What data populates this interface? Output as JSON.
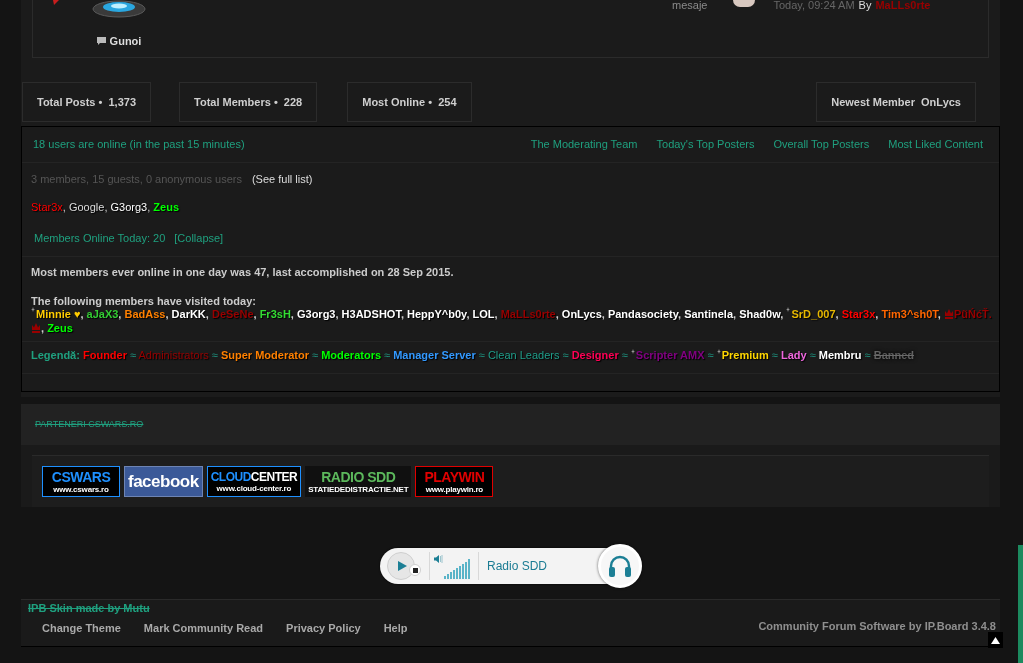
{
  "forum_row": {
    "forum": "Gunoi",
    "count_label": "mesaje",
    "last_post": {
      "time": "Today, 09:24 AM",
      "by": "By",
      "author": "MaLLs0rte"
    }
  },
  "stats": [
    {
      "label": "Total Posts •",
      "value": "1,373"
    },
    {
      "label": "Total Members •",
      "value": "228"
    },
    {
      "label": "Most Online •",
      "value": "254"
    },
    {
      "label": "Newest Member",
      "value": "OnLycs"
    }
  ],
  "online": {
    "title": "18 users are online (in the past 15 minutes)",
    "links": [
      "The Moderating Team",
      "Today's Top Posters",
      "Overall Top Posters",
      "Most Liked Content"
    ],
    "summary": "3 members, 15 guests, 0 anonymous users",
    "see_full_list": "(See full list)",
    "users": [
      {
        "name": "Star3x",
        "color": "#ff0000",
        "bold": false,
        "sep": ","
      },
      {
        "name": "Google",
        "color": "#dddddd",
        "bold": false,
        "sep": ","
      },
      {
        "name": "G3org3",
        "color": "#ffffff",
        "bold": false,
        "sep": ","
      },
      {
        "name": "Zeus",
        "color": "#00ff00",
        "bold": true
      }
    ],
    "today": "Members Online Today: 20",
    "collapse": "[Collapse]"
  },
  "records": {
    "most_online": "Most members ever online in one day was 47, last accomplished on 28 Sep 2015.",
    "visited_title": "The following members have visited today:",
    "visited": [
      {
        "name": "Minnie ♥",
        "color": "#ffcc00",
        "kind": "sparkle",
        "sep": ","
      },
      {
        "name": "aJaX3",
        "color": "#33cc33",
        "kind": "plain",
        "sep": ","
      },
      {
        "name": "BadAss",
        "color": "#ff8000",
        "kind": "plain",
        "sep": ","
      },
      {
        "name": "DarKK",
        "color": "#ffffff",
        "kind": "plain",
        "sep": ","
      },
      {
        "name": "DeSeNe",
        "color": "#990000",
        "kind": "plain",
        "sep": ","
      },
      {
        "name": "Fr3sH",
        "color": "#33dd33",
        "kind": "plain",
        "sep": ","
      },
      {
        "name": "G3org3",
        "color": "#ffffff",
        "kind": "plain",
        "sep": ","
      },
      {
        "name": "H3ADSHOT",
        "color": "#ffffff",
        "kind": "plain",
        "sep": ","
      },
      {
        "name": "HeppY^b0y",
        "color": "#ffffff",
        "kind": "plain",
        "sep": ","
      },
      {
        "name": "LOL",
        "color": "#ffffff",
        "kind": "plain",
        "sep": ","
      },
      {
        "name": "MaLLs0rte",
        "color": "#990000",
        "kind": "plain",
        "sep": ","
      },
      {
        "name": "OnLycs",
        "color": "#ffffff",
        "kind": "plain",
        "sep": ","
      },
      {
        "name": "Pandasociety",
        "color": "#ffffff",
        "kind": "plain",
        "sep": ","
      },
      {
        "name": "Santinela",
        "color": "#ffffff",
        "kind": "plain",
        "sep": ","
      },
      {
        "name": "Shad0w",
        "color": "#ffffff",
        "kind": "plain",
        "sep": ","
      },
      {
        "name": "SrD_007",
        "color": "#e6b800",
        "kind": "sparkle",
        "sep": ","
      },
      {
        "name": "Star3x",
        "color": "#ff0000",
        "kind": "plain",
        "sep": ","
      },
      {
        "name": "Tim3^sh0T",
        "color": "#ff6600",
        "kind": "plain",
        "sep": ","
      },
      {
        "name": "PũŃćŤ.",
        "color": "#990000",
        "kind": "emblem",
        "sep": ","
      },
      {
        "name": "Zeus",
        "color": "#00ff00",
        "kind": "plain"
      }
    ]
  },
  "legend": {
    "label": "Legendă:",
    "groups": [
      {
        "name": "Founder",
        "color": "#ff0000",
        "bold": true,
        "kind": "plain",
        "sep": "≈"
      },
      {
        "name": "Administrators",
        "color": "#990000",
        "bold": false,
        "kind": "plain",
        "sep": "≈"
      },
      {
        "name": "Super Moderator",
        "color": "#ff8000",
        "bold": true,
        "kind": "plain",
        "sep": "≈"
      },
      {
        "name": "Moderators",
        "color": "#00ff00",
        "bold": true,
        "kind": "plain",
        "sep": "≈"
      },
      {
        "name": "Manager Server",
        "color": "#3399ff",
        "bold": true,
        "kind": "plain",
        "sep": "≈"
      },
      {
        "name": "Clean Leaders",
        "color": "#1f9e8a",
        "bold": false,
        "kind": "plain",
        "sep": "≈"
      },
      {
        "name": "Designer",
        "color": "#ff0055",
        "bold": true,
        "kind": "plain",
        "sep": "≈"
      },
      {
        "name": "Scripter AMX",
        "color": "#800080",
        "bold": true,
        "kind": "sparkle",
        "sep": "≈"
      },
      {
        "name": "Premium",
        "color": "#ffd700",
        "bold": true,
        "kind": "sparkle",
        "sep": "≈"
      },
      {
        "name": "Lady",
        "color": "#ee66dd",
        "bold": true,
        "kind": "plain",
        "sep": "≈"
      },
      {
        "name": "Membru",
        "color": "#ffffff",
        "bold": true,
        "kind": "plain",
        "sep": "≈"
      },
      {
        "name": "Banned",
        "color": "#6a6a6a",
        "bold": true,
        "kind": "banned"
      }
    ]
  },
  "partners": {
    "title": "PARTENERI CSWARS.RO",
    "banners": [
      {
        "kind": "outlined",
        "color": "#1e90ff",
        "title": "CSWARS",
        "url": "www.cswars.ro"
      },
      {
        "kind": "filled",
        "color": "#3b5998",
        "title": "facebook"
      },
      {
        "kind": "outlined",
        "color": "#1e90ff",
        "title": "CLOUD",
        "title_2": "CENTER",
        "url": "www.cloud-center.ro"
      },
      {
        "kind": "plain",
        "color": "#5cb85c",
        "title": "RADIO SDD",
        "url": "STATIEDEDISTRACTIE.NET"
      },
      {
        "kind": "outlined",
        "color": "#e00000",
        "title": "PLAYWIN",
        "url": "www.playwin.ro"
      }
    ]
  },
  "radio": {
    "station": "Radio SDD"
  },
  "footer": {
    "credit": "IPB Skin made by Mutu",
    "links": [
      "Change Theme",
      "Mark Community Read",
      "Privacy Policy",
      "Help"
    ],
    "powered_by": "Community Forum Software by IP.Board 3.4.8"
  }
}
